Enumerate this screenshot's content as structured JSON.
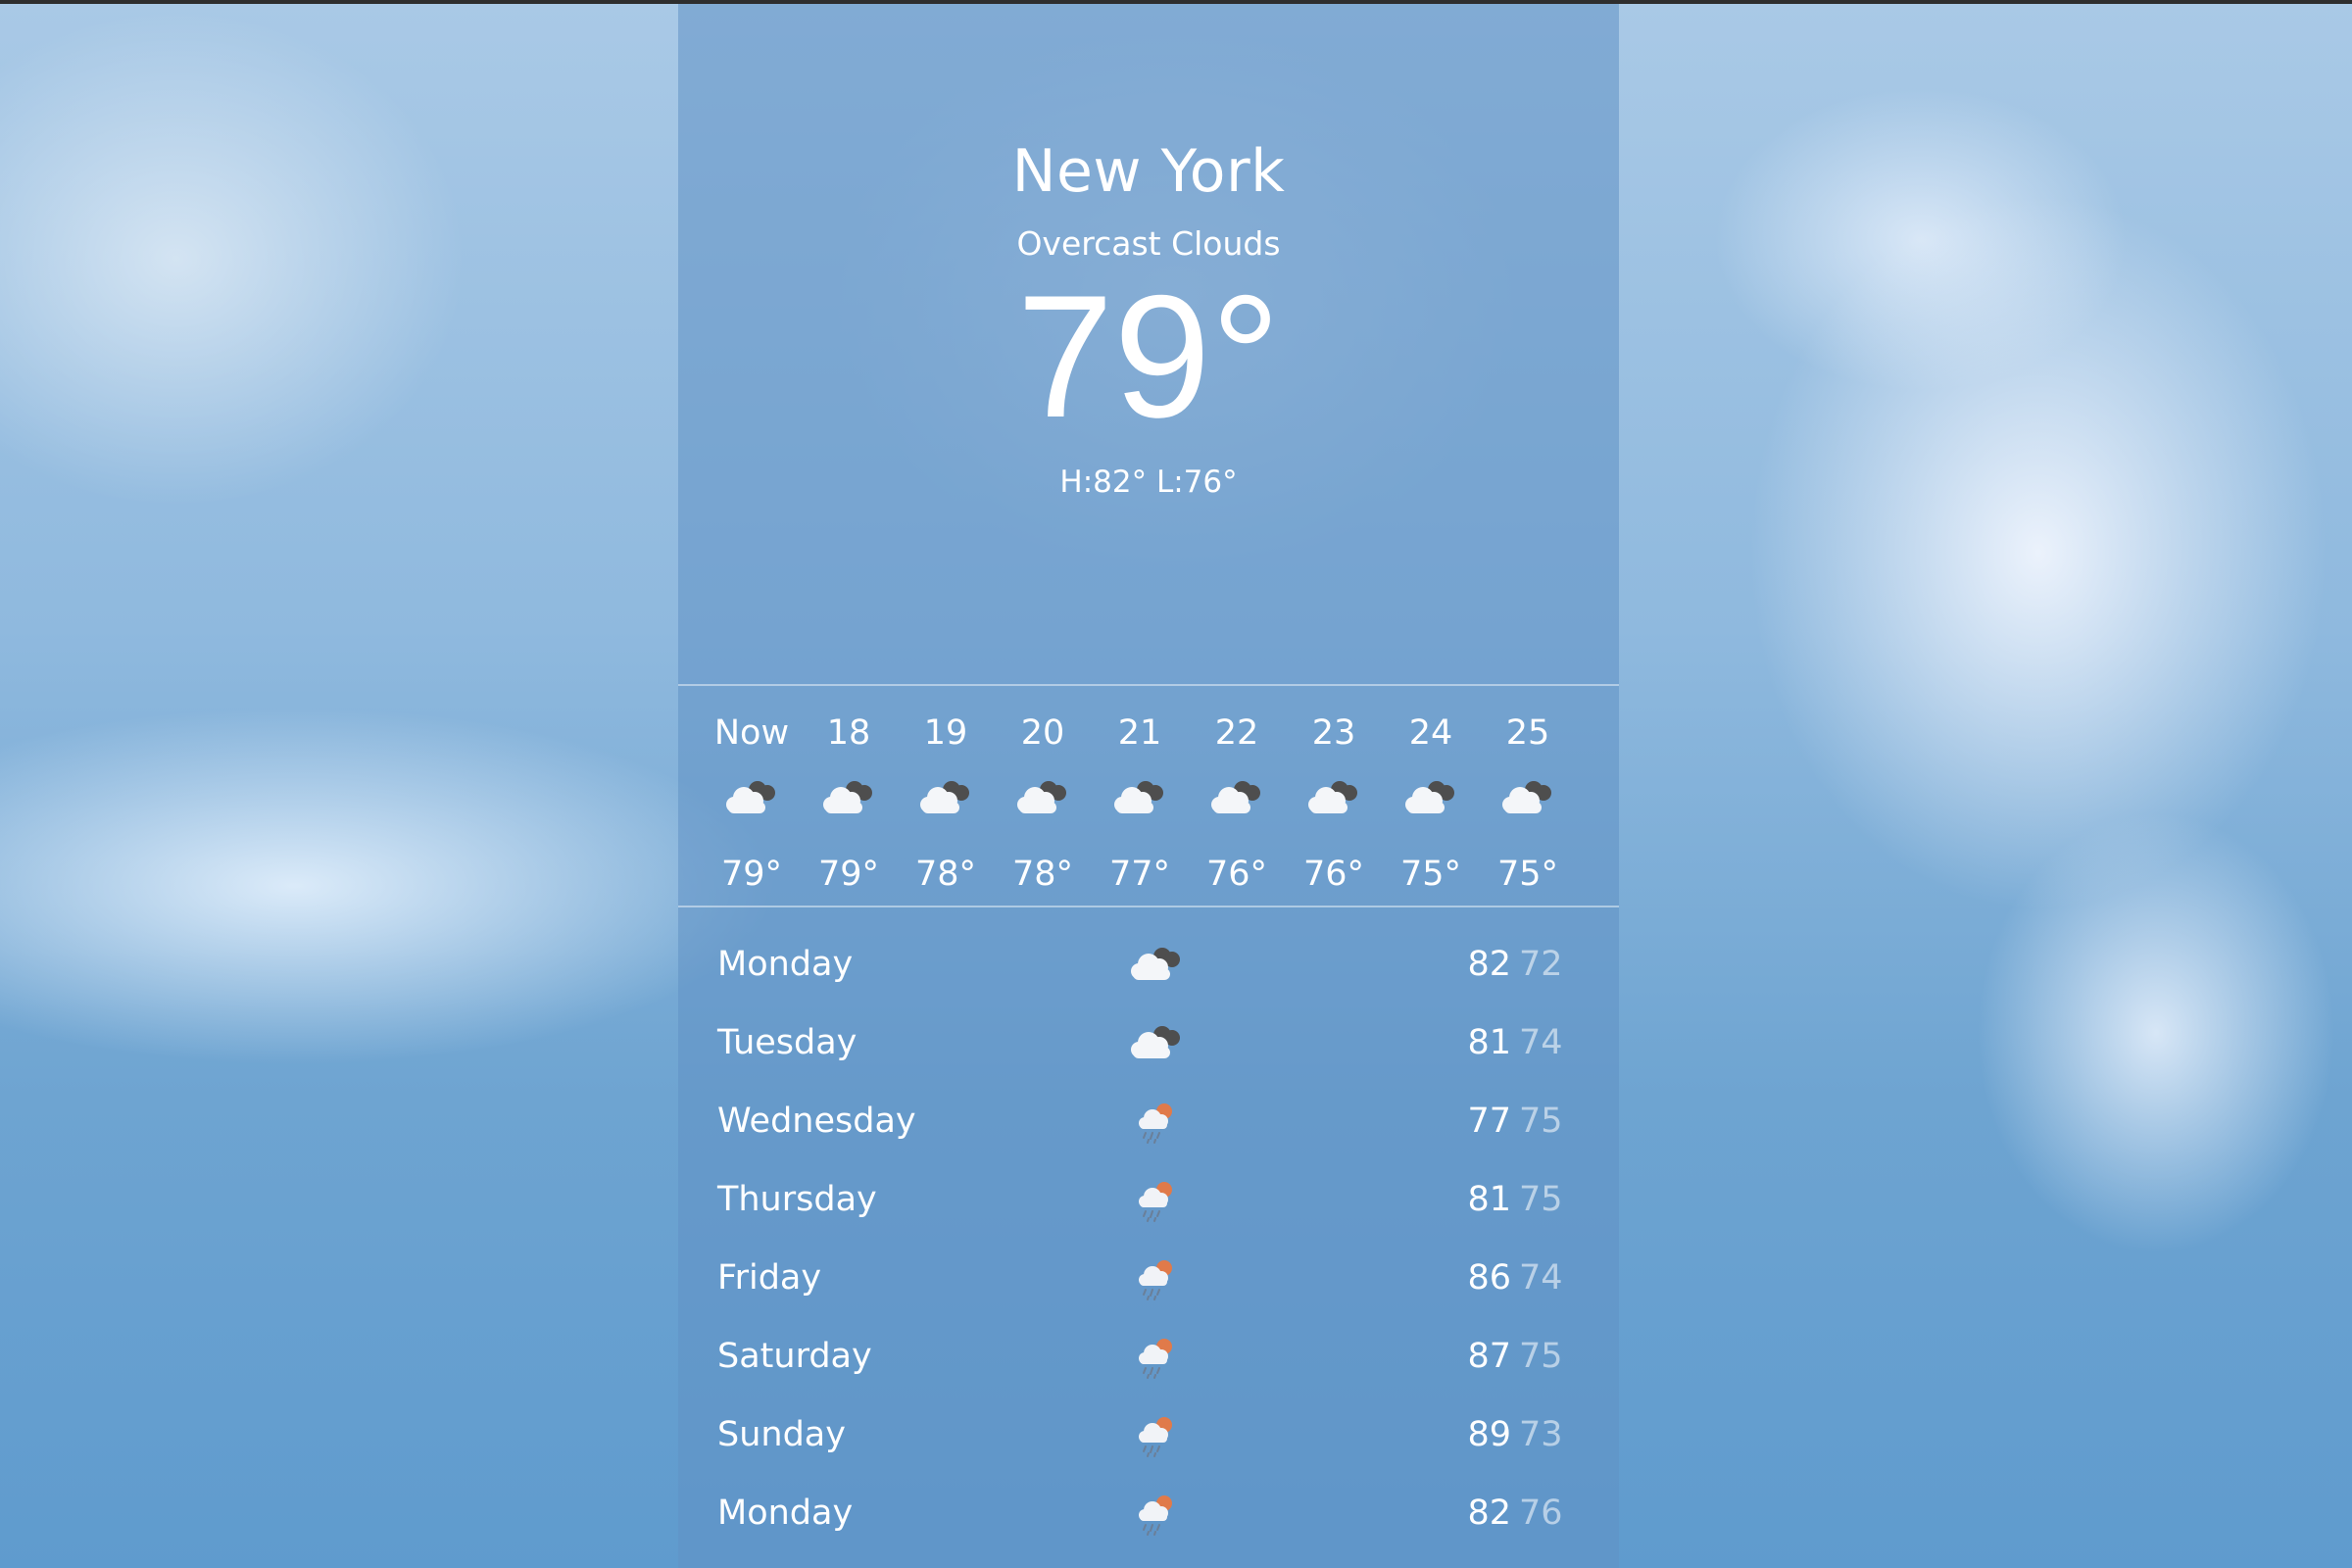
{
  "location": {
    "city": "New York",
    "condition": "Overcast Clouds",
    "temperature": "79°",
    "high_low": "H:82° L:76°"
  },
  "hourly": [
    {
      "label": "Now",
      "icon": "cloudy-icon",
      "temp": "79°"
    },
    {
      "label": "18",
      "icon": "cloudy-icon",
      "temp": "79°"
    },
    {
      "label": "19",
      "icon": "cloudy-icon",
      "temp": "78°"
    },
    {
      "label": "20",
      "icon": "cloudy-icon",
      "temp": "78°"
    },
    {
      "label": "21",
      "icon": "cloudy-icon",
      "temp": "77°"
    },
    {
      "label": "22",
      "icon": "cloudy-icon",
      "temp": "76°"
    },
    {
      "label": "23",
      "icon": "cloudy-icon",
      "temp": "76°"
    },
    {
      "label": "24",
      "icon": "cloudy-icon",
      "temp": "75°"
    },
    {
      "label": "25",
      "icon": "cloudy-icon",
      "temp": "75°"
    }
  ],
  "daily": [
    {
      "day": "Monday",
      "icon": "cloudy-icon",
      "high": "82",
      "low": "72"
    },
    {
      "day": "Tuesday",
      "icon": "cloudy-icon",
      "high": "81",
      "low": "74"
    },
    {
      "day": "Wednesday",
      "icon": "rain-icon",
      "high": "77",
      "low": "75"
    },
    {
      "day": "Thursday",
      "icon": "rain-icon",
      "high": "81",
      "low": "75"
    },
    {
      "day": "Friday",
      "icon": "rain-icon",
      "high": "86",
      "low": "74"
    },
    {
      "day": "Saturday",
      "icon": "rain-icon",
      "high": "87",
      "low": "75"
    },
    {
      "day": "Sunday",
      "icon": "rain-icon",
      "high": "89",
      "low": "73"
    },
    {
      "day": "Monday",
      "icon": "rain-icon",
      "high": "82",
      "low": "76"
    }
  ]
}
